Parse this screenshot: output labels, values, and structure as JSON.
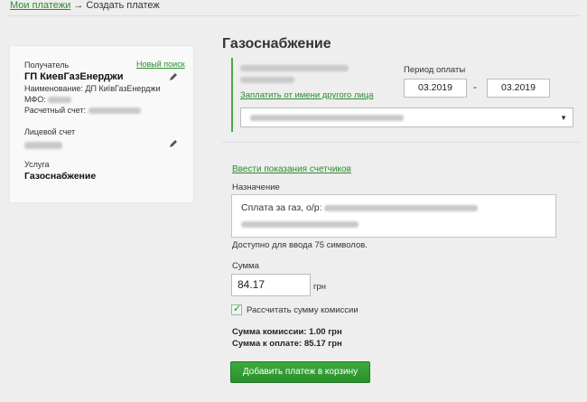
{
  "breadcrumb": {
    "parent": "Мои платежи",
    "separator": "→",
    "current": "Создать платеж"
  },
  "recipient_card": {
    "recipient_label": "Получатель",
    "new_search": "Новый поиск",
    "recipient_name": "ГП КиевГазЕнерджи",
    "name_line": "Наименование: ДП КиївГазЕнерджи",
    "mfo_label": "МФО:",
    "account_label": "Расчетный счет:",
    "personal_account_label": "Лицевой счет",
    "service_label": "Услуга",
    "service_value": "Газоснабжение"
  },
  "form": {
    "title": "Газоснабжение",
    "pay_for_other": "Заплатить от имени другого лица",
    "period_label": "Период оплаты",
    "period_from": "03.2019",
    "period_dash": "-",
    "period_to": "03.2019",
    "meter_link": "Ввести показания счетчиков",
    "purpose_label": "Назначение",
    "purpose_text": "Сплата за газ, о/р:",
    "available_chars": "Доступно для ввода 75 символов.",
    "sum_label": "Сумма",
    "sum_value": "84.17",
    "currency": "грн",
    "calc_commission_label": "Рассчитать сумму комиссии",
    "commission_line": "Сумма комиссии:   1.00 грн",
    "total_line": "Сумма к оплате:   85.17 грн",
    "add_button": "Добавить платеж в корзину"
  },
  "colors": {
    "accent_green": "#2a8d2f",
    "button_green": "#34a034",
    "background": "#eeeeee"
  }
}
